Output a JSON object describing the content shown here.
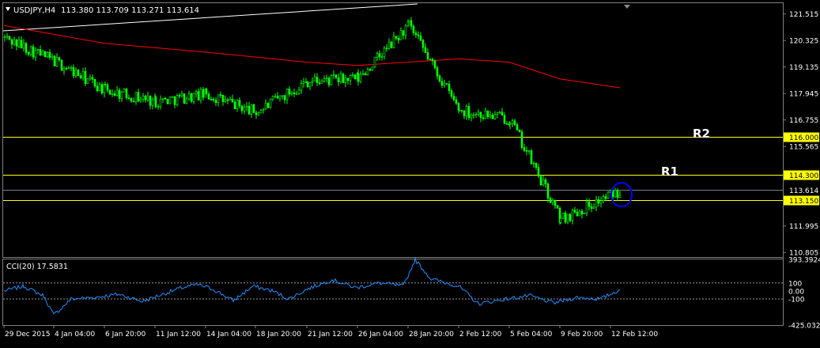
{
  "header": {
    "symbol": "USDJPY,H4",
    "ohlc": "113.380 113.709 113.271 113.614"
  },
  "price_axis": {
    "ticks": [
      "121.515",
      "120.325",
      "119.135",
      "117.945",
      "116.755",
      "115.565",
      "111.995",
      "110.805"
    ],
    "price_levels": [
      {
        "label": "116.000",
        "kind": "resistance",
        "color": "#ffff00"
      },
      {
        "label": "114.300",
        "kind": "resistance",
        "color": "#ffff00"
      },
      {
        "label": "113.614",
        "kind": "current",
        "color": "#708090"
      },
      {
        "label": "113.150",
        "kind": "support",
        "color": "#ffff00"
      }
    ]
  },
  "annotations": {
    "r1": "R1",
    "r2": "R2"
  },
  "indicator": {
    "label": "CCI(20) 17.5831",
    "ticks": [
      "393.3924",
      "100",
      "0.00",
      "-100",
      "-425.0324"
    ]
  },
  "time_axis": {
    "labels": [
      "29 Dec 2015",
      "4 Jan 04:00",
      "6 Jan 20:00",
      "11 Jan 12:00",
      "14 Jan 04:00",
      "18 Jan 20:00",
      "21 Jan 12:00",
      "26 Jan 04:00",
      "28 Jan 20:00",
      "2 Feb 12:00",
      "5 Feb 04:00",
      "9 Feb 20:00",
      "12 Feb 12:00"
    ]
  },
  "colors": {
    "background": "#000000",
    "candle": "#00ff00",
    "moving_average": "#ff0000",
    "trendline": "#ffffff",
    "level_line": "#ffff00",
    "current_price": "#708090",
    "cci_line": "#1e90ff",
    "highlight_circle": "#0000ff",
    "axis_text": "#ffffff"
  },
  "chart_data": {
    "type": "candlestick",
    "symbol": "USDJPY",
    "timeframe": "H4",
    "close_path": [
      [
        "29 Dec 2015",
        120.45
      ],
      [
        "4 Jan 04:00",
        119.4
      ],
      [
        "6 Jan 20:00",
        118.1
      ],
      [
        "11 Jan 12:00",
        117.6
      ],
      [
        "14 Jan 04:00",
        117.9
      ],
      [
        "18 Jan 20:00",
        117.1
      ],
      [
        "21 Jan 12:00",
        118.5
      ],
      [
        "26 Jan 04:00",
        118.6
      ],
      [
        "28 Jan 20:00",
        121.0
      ],
      [
        "2 Feb 12:00",
        117.2
      ],
      [
        "5 Feb 04:00",
        116.8
      ],
      [
        "9 Feb 20:00",
        112.3
      ],
      [
        "12 Feb 12:00",
        113.614
      ]
    ],
    "moving_average": [
      [
        "29 Dec 2015",
        121.0
      ],
      [
        "6 Jan 20:00",
        120.2
      ],
      [
        "14 Jan 04:00",
        119.8
      ],
      [
        "21 Jan 12:00",
        119.35
      ],
      [
        "26 Jan 04:00",
        119.2
      ],
      [
        "2 Feb 12:00",
        119.5
      ],
      [
        "5 Feb 04:00",
        119.35
      ],
      [
        "9 Feb 20:00",
        118.6
      ],
      [
        "12 Feb 12:00",
        118.2
      ]
    ],
    "levels": [
      116.0,
      114.3,
      113.614,
      113.15
    ],
    "ylim": [
      110.6,
      122.0
    ],
    "cci": {
      "last": 17.5831,
      "ylim": [
        -425.0324,
        393.3924
      ],
      "reference_lines": [
        100,
        -100
      ]
    }
  }
}
